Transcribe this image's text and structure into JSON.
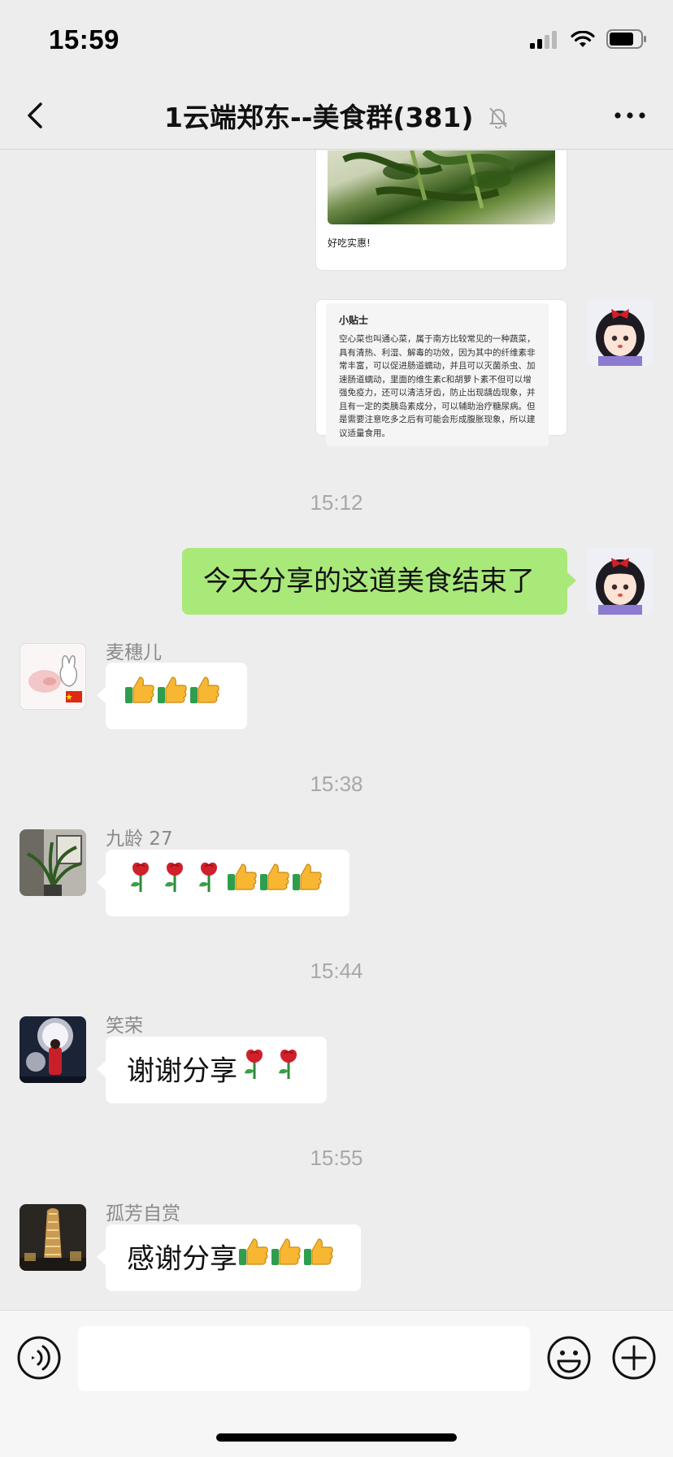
{
  "status_bar": {
    "time": "15:59",
    "signal_icon": "cell-signal-icon",
    "wifi_icon": "wifi-icon",
    "battery_icon": "battery-icon"
  },
  "nav": {
    "title": "1云端郑东--美食群(381)",
    "back_icon": "chevron-left-icon",
    "mute_icon": "bell-slash-icon",
    "more_icon": "more-icon"
  },
  "cards": {
    "dish": {
      "caption": "好吃实惠!"
    },
    "tip": {
      "title": "小贴士",
      "body": "空心菜也叫通心菜，属于南方比较常见的一种蔬菜，具有清热、利湿、解毒的功效，因为其中的纤维素非常丰富，可以促进肠道蠕动，并且可以灭菌杀虫、加速肠道蠕动，里面的维生素c和胡萝卜素不但可以增强免疫力，还可以清洁牙齿，防止出现龋齿现象，并且有一定的类胰岛素成分，可以辅助治疗糖尿病。但是需要注意吃多之后有可能会形成腹胀现象，所以建议适量食用。"
    }
  },
  "messages": [
    {
      "type": "time",
      "text": "15:12"
    },
    {
      "type": "self",
      "text": "今天分享的这道美食结束了"
    },
    {
      "type": "other",
      "sender": "麦穗儿",
      "text": "",
      "emojis": [
        "thumbs-up-icon",
        "thumbs-up-icon",
        "thumbs-up-icon"
      ]
    },
    {
      "type": "time",
      "text": "15:38"
    },
    {
      "type": "other",
      "sender": "九龄 27",
      "text": "",
      "emojis": [
        "rose-icon",
        "rose-icon",
        "rose-icon",
        "thumbs-up-icon",
        "thumbs-up-icon",
        "thumbs-up-icon"
      ]
    },
    {
      "type": "time",
      "text": "15:44"
    },
    {
      "type": "other",
      "sender": "笑荣",
      "text": "谢谢分享",
      "emojis": [
        "rose-icon",
        "rose-icon"
      ]
    },
    {
      "type": "time",
      "text": "15:55"
    },
    {
      "type": "other",
      "sender": "孤芳自赏",
      "text": "感谢分享",
      "emojis": [
        "thumbs-up-icon",
        "thumbs-up-icon",
        "thumbs-up-icon"
      ]
    }
  ],
  "input": {
    "value": "",
    "voice_icon": "voice-icon",
    "emoji_icon": "smiley-icon",
    "plus_icon": "plus-circle-icon"
  },
  "colors": {
    "background": "#ededed",
    "self_bubble": "#a9e97a",
    "other_bubble": "#ffffff"
  }
}
